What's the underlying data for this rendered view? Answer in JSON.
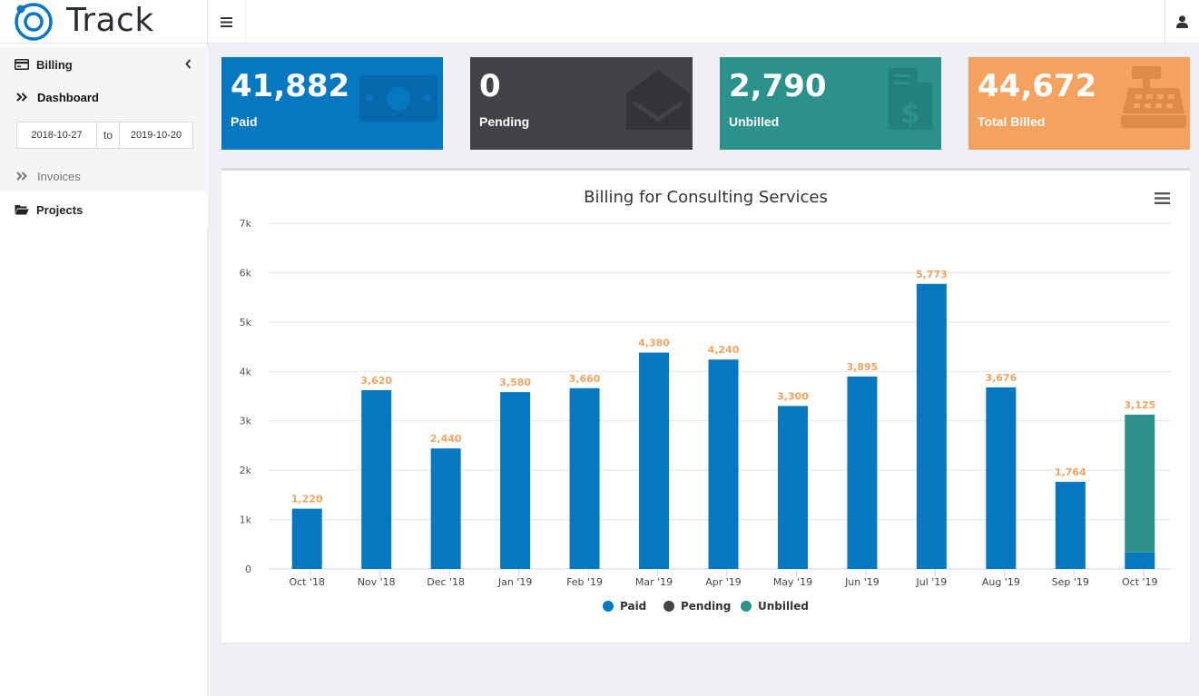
{
  "app": {
    "name": "Track"
  },
  "sidebar": {
    "billing_label": "Billing",
    "dashboard_label": "Dashboard",
    "date_from": "2018-10-27",
    "date_sep": "to",
    "date_to": "2019-10-20",
    "invoices_label": "Invoices",
    "projects_label": "Projects"
  },
  "cards": {
    "paid": {
      "value": "41,882",
      "label": "Paid",
      "icon": "money-bill-icon",
      "color": "#0677c1"
    },
    "pending": {
      "value": "0",
      "label": "Pending",
      "icon": "envelope-open-icon",
      "color": "#424346"
    },
    "unbilled": {
      "value": "2,790",
      "label": "Unbilled",
      "icon": "file-invoice-dollar-icon",
      "color": "#2b928b"
    },
    "total": {
      "value": "44,672",
      "label": "Total Billed",
      "icon": "cash-register-icon",
      "color": "#f6a15d"
    }
  },
  "chart_data": {
    "type": "bar",
    "stacked": true,
    "title": "Billing for Consulting Services",
    "categories": [
      "Oct '18",
      "Nov '18",
      "Dec '18",
      "Jan '19",
      "Feb '19",
      "Mar '19",
      "Apr '19",
      "May '19",
      "Jun '19",
      "Jul '19",
      "Aug '19",
      "Sep '19",
      "Oct '19"
    ],
    "series": [
      {
        "name": "Paid",
        "color": "#0677c1",
        "values": [
          1220,
          3620,
          2440,
          3580,
          3660,
          4380,
          4240,
          3300,
          3895,
          5773,
          3676,
          1764,
          335
        ]
      },
      {
        "name": "Pending",
        "color": "#424346",
        "values": [
          0,
          0,
          0,
          0,
          0,
          0,
          0,
          0,
          0,
          0,
          0,
          0,
          0
        ]
      },
      {
        "name": "Unbilled",
        "color": "#2b928b",
        "values": [
          0,
          0,
          0,
          0,
          0,
          0,
          0,
          0,
          0,
          0,
          0,
          0,
          2790
        ]
      }
    ],
    "totals_labels": [
      "1,220",
      "3,620",
      "2,440",
      "3,580",
      "3,660",
      "4,380",
      "4,240",
      "3,300",
      "3,895",
      "5,773",
      "3,676",
      "1,764",
      "3,125"
    ],
    "yticks": [
      "0",
      "1k",
      "2k",
      "3k",
      "4k",
      "5k",
      "6k",
      "7k"
    ],
    "ylim": [
      0,
      7000
    ],
    "legend_position": "bottom",
    "grid": true,
    "label_color": "#f4a460"
  }
}
